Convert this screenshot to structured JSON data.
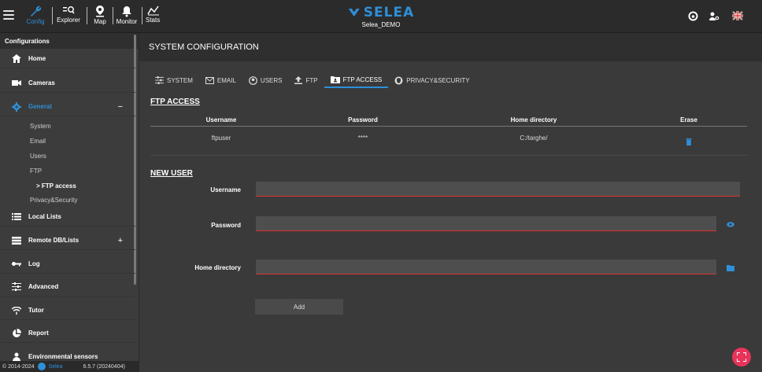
{
  "topbar": {
    "nav": [
      {
        "label": "Config",
        "icon": "wrench-icon"
      },
      {
        "label": "Explorer",
        "icon": "search-list-icon"
      },
      {
        "label": "Map",
        "icon": "map-pin-icon"
      },
      {
        "label": "Monitor",
        "icon": "bell-icon"
      },
      {
        "label": "Stats",
        "icon": "chart-icon"
      }
    ],
    "brand": "SELEA",
    "device": "Selea_DEMO",
    "accent": "#2f8fd8"
  },
  "sidebar": {
    "header": "Configurations",
    "items": [
      {
        "label": "Home",
        "icon": "home-icon"
      },
      {
        "label": "Cameras",
        "icon": "camera-icon"
      },
      {
        "label": "General",
        "icon": "gear-icon",
        "toggle": "−"
      },
      {
        "label": "Local Lists",
        "icon": "list-icon"
      },
      {
        "label": "Remote DB/Lists",
        "icon": "database-icon",
        "toggle": "+"
      },
      {
        "label": "Log",
        "icon": "key-icon"
      },
      {
        "label": "Advanced",
        "icon": "sliders-icon"
      },
      {
        "label": "Tutor",
        "icon": "wifi-icon"
      },
      {
        "label": "Report",
        "icon": "pie-icon"
      },
      {
        "label": "Environmental sensors",
        "icon": "sensor-icon"
      }
    ],
    "subitems": [
      "System",
      "Email",
      "Users",
      "FTP",
      "> FTP access",
      "Privacy&Security"
    ],
    "footer": {
      "copyright": "© 2014-2024",
      "brand": "Selea",
      "version": "6.5.7 (20240404)"
    }
  },
  "main": {
    "title": "SYSTEM CONFIGURATION",
    "tabs": [
      "SYSTEM",
      "EMAIL",
      "USERS",
      "FTP",
      "FTP ACCESS",
      "PRIVACY&SECURITY"
    ],
    "ftp_section": "FTP ACCESS",
    "columns": [
      "Username",
      "Password",
      "Home directory",
      "Erase"
    ],
    "rows": [
      {
        "username": "ftpuser",
        "password": "****",
        "home": "C:/targhe/"
      }
    ],
    "new_user_section": "NEW USER",
    "form": {
      "username_label": "Username",
      "password_label": "Password",
      "home_label": "Home directory",
      "add_label": "Add"
    }
  }
}
